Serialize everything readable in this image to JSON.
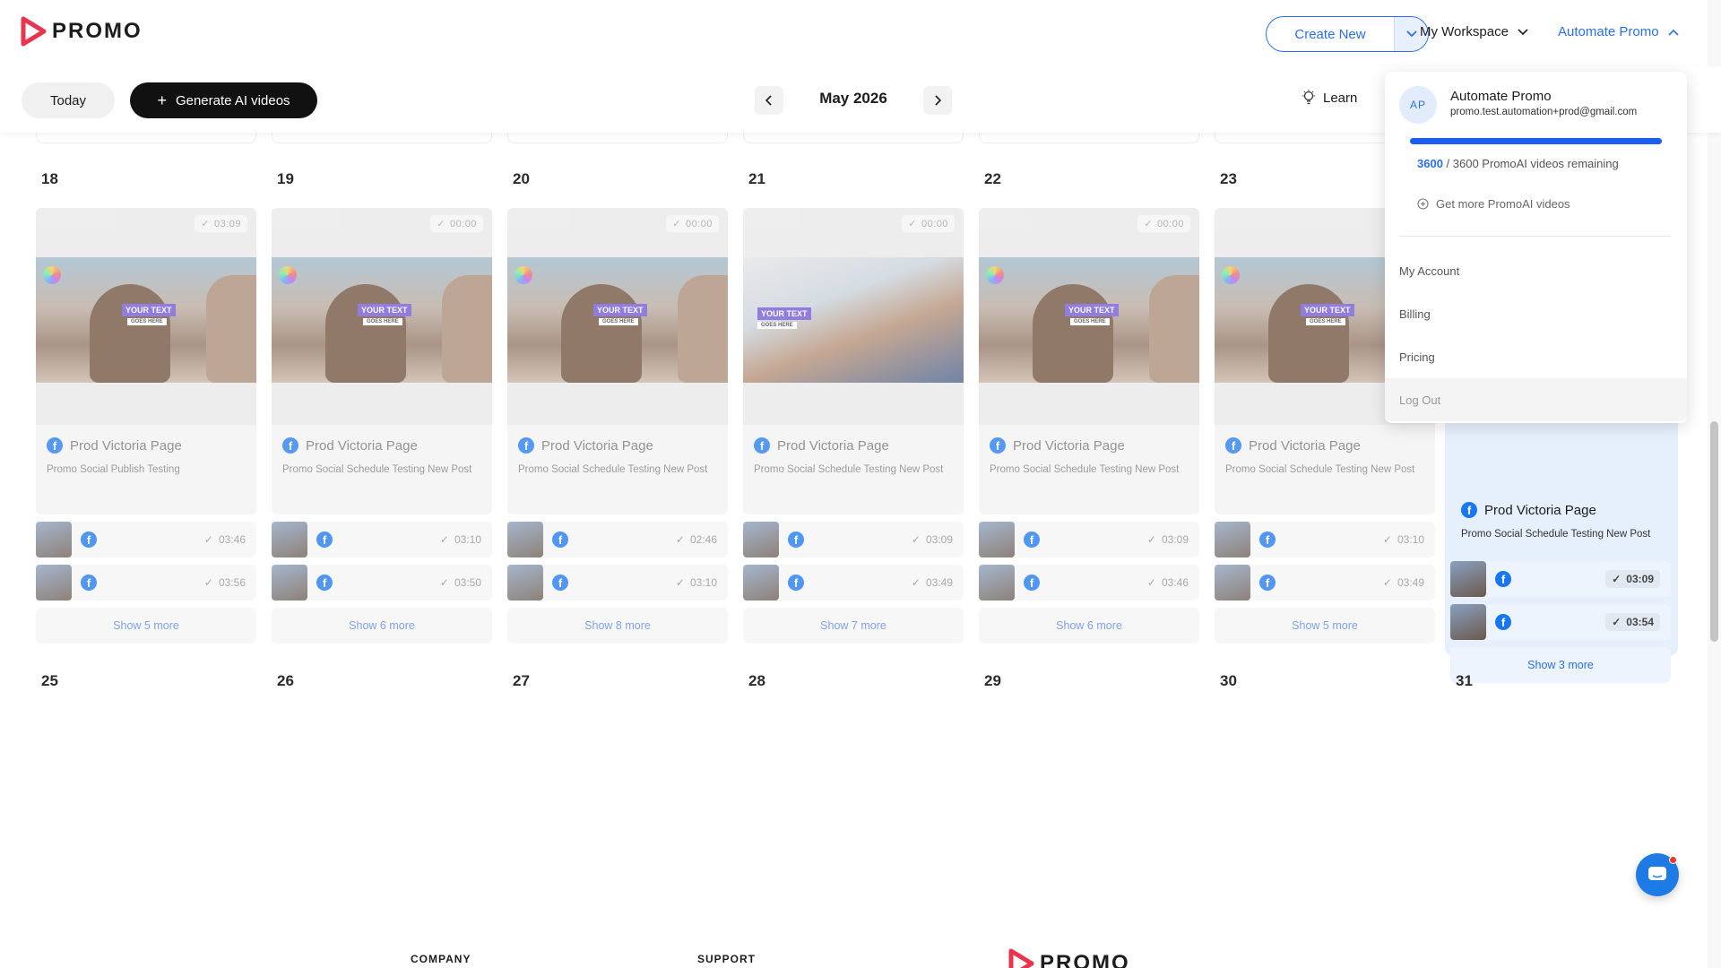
{
  "header": {
    "logo_text": "PROMO",
    "create_new_label": "Create New",
    "workspace_label": "My Workspace",
    "account_label": "Automate Promo"
  },
  "toolbar": {
    "today_label": "Today",
    "generate_label": "Generate AI videos",
    "month_label": "May 2026",
    "learn_label": "Learn"
  },
  "calendar": {
    "week1_days": [
      "18",
      "19",
      "20",
      "21",
      "22",
      "23"
    ],
    "week2_days": [
      "25",
      "26",
      "27",
      "28",
      "29",
      "30",
      "31"
    ],
    "columns": [
      {
        "day": "18",
        "duration": "03:09",
        "page": "Prod Victoria Page",
        "title": "Promo Social Publish Testing",
        "scene": "festival",
        "mini": [
          "03:46",
          "03:56"
        ],
        "more": "Show 5 more"
      },
      {
        "day": "19",
        "duration": "00:00",
        "page": "Prod Victoria Page",
        "title": "Promo Social Schedule Testing New Post",
        "scene": "festival",
        "mini": [
          "03:10",
          "03:50"
        ],
        "more": "Show 6 more"
      },
      {
        "day": "20",
        "duration": "00:00",
        "page": "Prod Victoria Page",
        "title": "Promo Social Schedule Testing New Post",
        "scene": "festival",
        "mini": [
          "02:46",
          "03:10"
        ],
        "more": "Show 8 more"
      },
      {
        "day": "21",
        "duration": "00:00",
        "page": "Prod Victoria Page",
        "title": "Promo Social Schedule Testing New Post",
        "scene": "child",
        "mini": [
          "03:09",
          "03:49"
        ],
        "more": "Show 7 more"
      },
      {
        "day": "22",
        "duration": "00:00",
        "page": "Prod Victoria Page",
        "title": "Promo Social Schedule Testing New Post",
        "scene": "festival",
        "mini": [
          "03:09",
          "03:46"
        ],
        "more": "Show 6 more"
      },
      {
        "day": "23",
        "duration": "",
        "page": "Prod Victoria Page",
        "title": "Promo Social Schedule Testing New Post",
        "scene": "festival",
        "mini": [
          "03:10",
          "03:49"
        ],
        "more": "Show 5 more"
      }
    ],
    "highlight": {
      "page": "Prod Victoria Page",
      "title": "Promo Social Schedule Testing New Post",
      "mini": [
        "03:09",
        "03:54"
      ],
      "more": "Show 3 more"
    },
    "thumb_text_1": "YOUR TEXT",
    "thumb_text_2": "GOES HERE"
  },
  "account_menu": {
    "initials": "AP",
    "name": "Automate Promo",
    "email": "promo.test.automation+prod@gmail.com",
    "remaining_count": "3600",
    "remaining_text": " / 3600 PromoAI videos remaining",
    "progress_fraction": 1.0,
    "get_more": "Get more PromoAI videos",
    "items": [
      "My Account",
      "Billing",
      "Pricing",
      "Log Out"
    ]
  },
  "footer": {
    "company": "COMPANY",
    "support": "SUPPORT",
    "logo_text": "PROMO"
  },
  "colors": {
    "accent": "#2a6ff0",
    "brand": "#e8344e",
    "dark": "#111111"
  }
}
